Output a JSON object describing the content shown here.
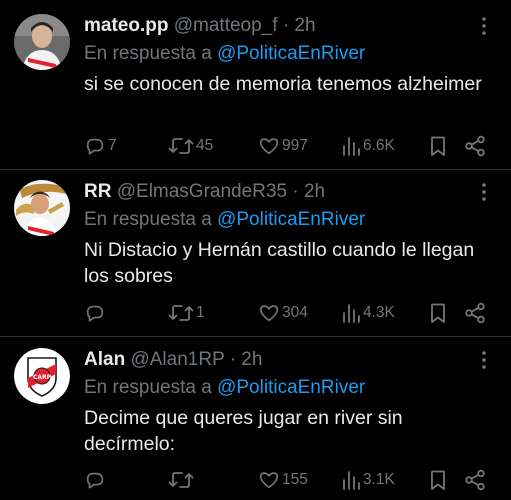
{
  "tweets": [
    {
      "display_name": "mateo.pp",
      "handle": "@matteop_f",
      "dot": "·",
      "time": "2h",
      "reply_prefix": "En respuesta a",
      "reply_mention": "@PoliticaEnRiver",
      "text": "si se conocen de memoria tenemos alzheimer",
      "replies": "7",
      "reposts": "45",
      "likes": "997",
      "views": "6.6K"
    },
    {
      "display_name": "RR",
      "handle": "@ElmasGrandeR35",
      "dot": "·",
      "time": "2h",
      "reply_prefix": "En respuesta a",
      "reply_mention": "@PoliticaEnRiver",
      "text": "Ni Distacio y Hernán castillo cuando le llegan los sobres",
      "replies": "",
      "reposts": "1",
      "likes": "304",
      "views": "4.3K"
    },
    {
      "display_name": "Alan",
      "handle": "@Alan1RP",
      "dot": "·",
      "time": "2h",
      "reply_prefix": "En respuesta a",
      "reply_mention": "@PoliticaEnRiver",
      "text": "Decime que queres jugar en river sin decírmelo:",
      "replies": "",
      "reposts": "",
      "likes": "155",
      "views": "3.1K",
      "avatar_badge_text": "CARP"
    }
  ],
  "colors": {
    "background": "#000000",
    "text": "#e7e9ea",
    "muted": "#71767b",
    "link": "#1d9bf0",
    "divider": "#2f3336",
    "river_red": "#e3212b"
  },
  "icons": [
    "reply-icon",
    "repost-icon",
    "like-icon",
    "views-icon",
    "bookmark-icon",
    "share-icon",
    "more-icon"
  ]
}
